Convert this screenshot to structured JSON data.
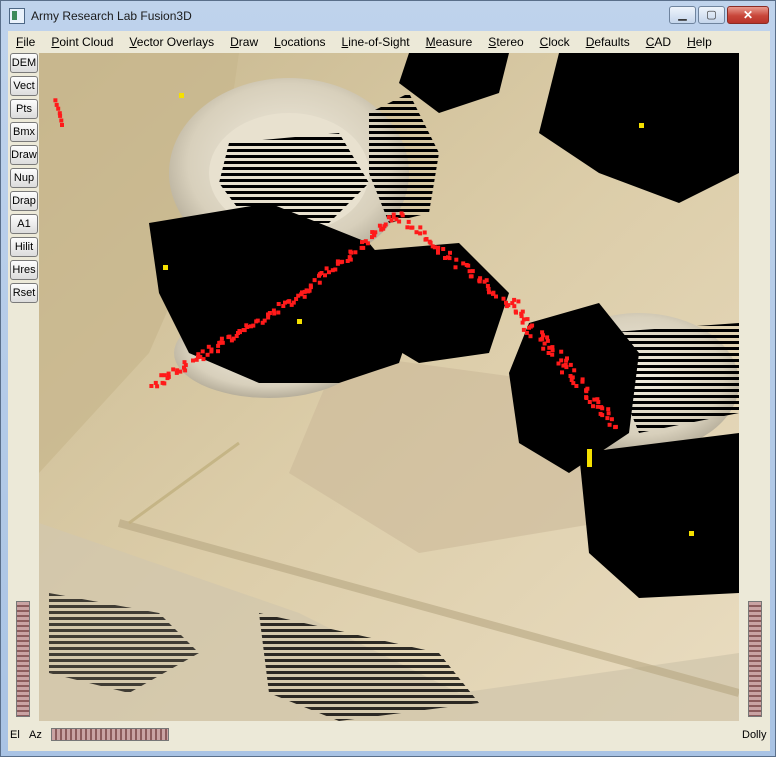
{
  "window": {
    "title": "Army Research Lab Fusion3D",
    "minimize_glyph": "▁",
    "maximize_glyph": "▢",
    "close_glyph": "✕"
  },
  "menu": [
    {
      "label": "File",
      "key": "F",
      "rest": "ile"
    },
    {
      "label": "Point Cloud",
      "key": "P",
      "rest": "oint Cloud"
    },
    {
      "label": "Vector Overlays",
      "key": "V",
      "rest": "ector Overlays"
    },
    {
      "label": "Draw",
      "key": "D",
      "rest": "raw"
    },
    {
      "label": "Locations",
      "key": "L",
      "rest": "ocations"
    },
    {
      "label": "Line-of-Sight",
      "key": "L",
      "rest": "ine-of-Sight"
    },
    {
      "label": "Measure",
      "key": "M",
      "rest": "easure"
    },
    {
      "label": "Stereo",
      "key": "S",
      "rest": "tereo"
    },
    {
      "label": "Clock",
      "key": "C",
      "rest": "lock"
    },
    {
      "label": "Defaults",
      "key": "D",
      "rest": "efaults"
    },
    {
      "label": "CAD",
      "key": "C",
      "rest": "AD"
    },
    {
      "label": "Help",
      "key": "H",
      "rest": "elp"
    }
  ],
  "toolbar": [
    {
      "id": "dem",
      "label": "DEM"
    },
    {
      "id": "vect",
      "label": "Vect"
    },
    {
      "id": "pts",
      "label": "Pts"
    },
    {
      "id": "bmx",
      "label": "Bmx"
    },
    {
      "id": "draw",
      "label": "Draw"
    },
    {
      "id": "nup",
      "label": "Nup"
    },
    {
      "id": "drap",
      "label": "Drap"
    },
    {
      "id": "a1",
      "label": "A1"
    },
    {
      "id": "hilit",
      "label": "Hilit"
    },
    {
      "id": "hres",
      "label": "Hres"
    },
    {
      "id": "rset",
      "label": "Rset"
    }
  ],
  "bottom": {
    "el_label": "El",
    "az_label": "Az",
    "dolly_label": "Dolly"
  },
  "colors": {
    "track": "#ff1a1a",
    "terrain": "#d9c9a6",
    "shadow": "#000000"
  }
}
